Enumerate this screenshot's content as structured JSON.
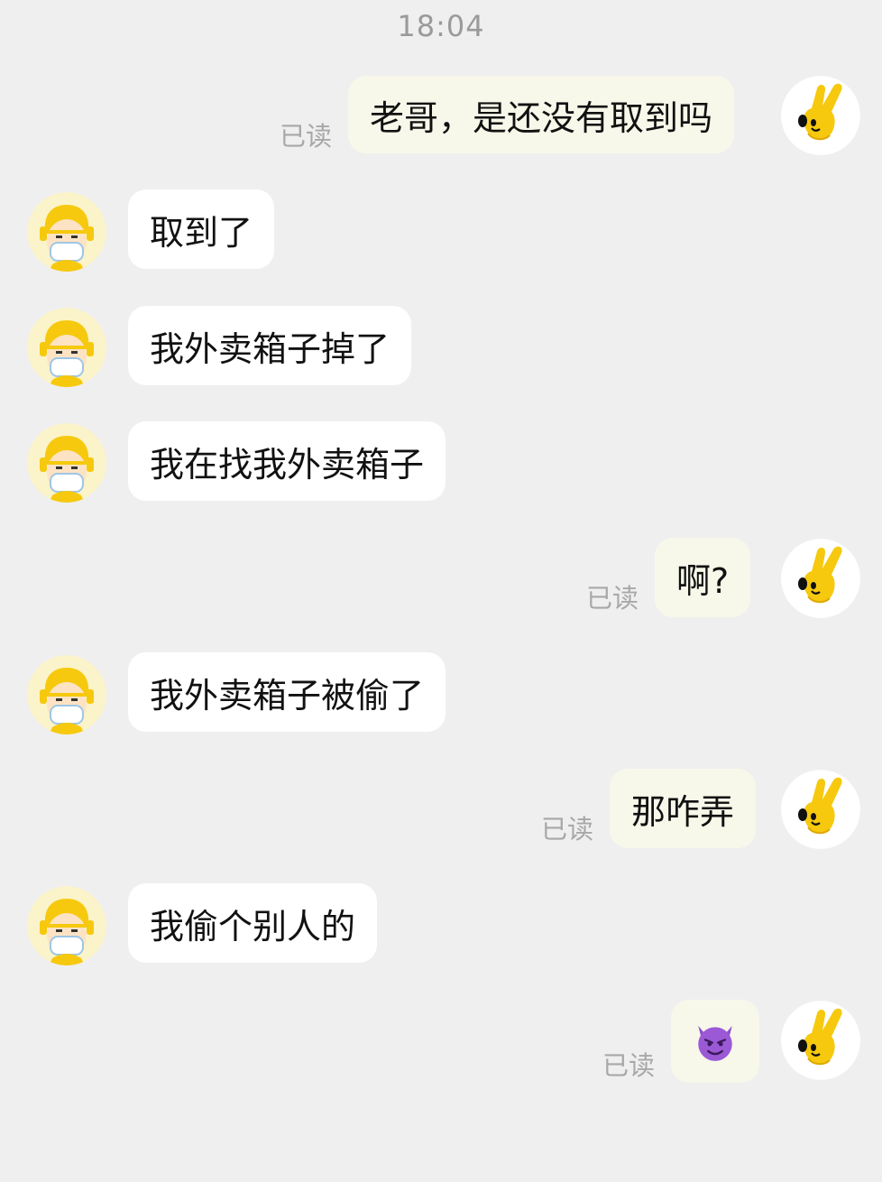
{
  "status": {
    "time": "18:04"
  },
  "messages": [
    {
      "side": "out",
      "text": "老哥，是还没有取到吗",
      "read": "已读"
    },
    {
      "side": "in",
      "text": "取到了"
    },
    {
      "side": "in",
      "text": "我外卖箱子掉了"
    },
    {
      "side": "in",
      "text": "我在找我外卖箱子"
    },
    {
      "side": "out",
      "text": "啊?",
      "read": "已读"
    },
    {
      "side": "in",
      "text": "我外卖箱子被偷了"
    },
    {
      "side": "out",
      "text": "那咋弄",
      "read": "已读"
    },
    {
      "side": "in",
      "text": "我偷个别人的"
    },
    {
      "side": "out",
      "emoji": "devil-emoji",
      "read": "已读"
    }
  ],
  "icons": {
    "me_avatar": "yellow-hand-mascot-icon",
    "courier_avatar": "delivery-rider-masked-icon"
  },
  "colors": {
    "background": "#efefef",
    "incoming_bubble": "#ffffff",
    "outgoing_bubble": "#f7f8ea",
    "read_text": "#a8a8a8"
  }
}
